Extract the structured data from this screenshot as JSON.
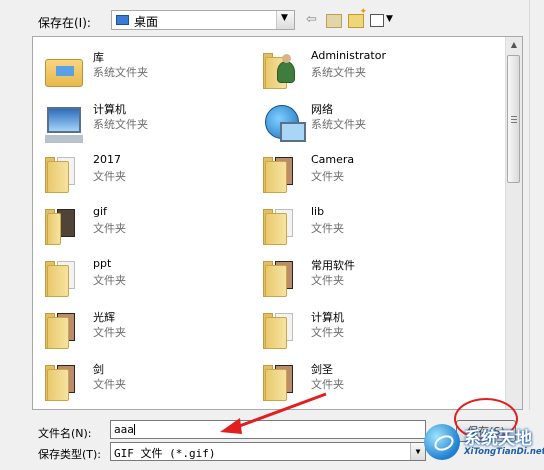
{
  "toolbar": {
    "save_in_label": "保存在(I):",
    "location": "桌面",
    "back_glyph": "⇦",
    "drop_glyph": "▼"
  },
  "items": [
    {
      "name": "库",
      "type": "系统文件夹",
      "icon": "library-icon"
    },
    {
      "name": "Administrator",
      "type": "系统文件夹",
      "icon": "user-folder-icon"
    },
    {
      "name": "计算机",
      "type": "系统文件夹",
      "icon": "computer-icon"
    },
    {
      "name": "网络",
      "type": "系统文件夹",
      "icon": "network-icon"
    },
    {
      "name": "2017",
      "type": "文件夹",
      "icon": "folder-icon"
    },
    {
      "name": "Camera",
      "type": "文件夹",
      "icon": "folder-icon"
    },
    {
      "name": "gif",
      "type": "文件夹",
      "icon": "folder-icon"
    },
    {
      "name": "lib",
      "type": "文件夹",
      "icon": "folder-icon"
    },
    {
      "name": "ppt",
      "type": "文件夹",
      "icon": "folder-icon"
    },
    {
      "name": "常用软件",
      "type": "文件夹",
      "icon": "folder-icon"
    },
    {
      "name": "光辉",
      "type": "文件夹",
      "icon": "folder-icon"
    },
    {
      "name": "计算机",
      "type": "文件夹",
      "icon": "folder-icon"
    },
    {
      "name": "剑",
      "type": "文件夹",
      "icon": "folder-icon"
    },
    {
      "name": "剑圣",
      "type": "文件夹",
      "icon": "folder-icon"
    }
  ],
  "bottom": {
    "filename_label": "文件名(N):",
    "filename_value": "aaa",
    "filetype_label": "保存类型(T):",
    "filetype_value": "GIF 文件 (*.gif)",
    "save_button": "保存(S)"
  },
  "watermark": {
    "cn": "系统天地",
    "en": "XiTongTianDi.net"
  },
  "colors": {
    "annotation_red": "#e21f1f",
    "folder_yellow": "#f6e3a0"
  }
}
